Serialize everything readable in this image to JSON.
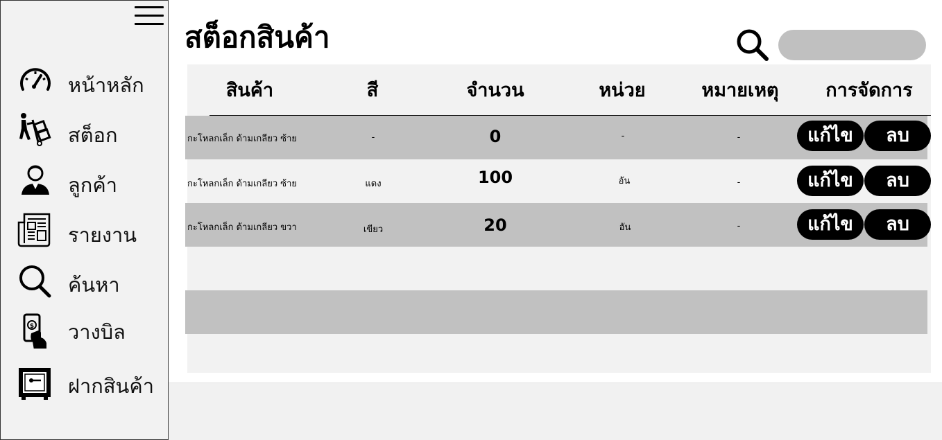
{
  "sidebar": {
    "items": [
      {
        "label": "หน้าหลัก",
        "icon": "speedometer-icon"
      },
      {
        "label": "สต็อก",
        "icon": "hand-truck-icon"
      },
      {
        "label": "ลูกค้า",
        "icon": "customer-icon"
      },
      {
        "label": "รายงาน",
        "icon": "newspaper-icon"
      },
      {
        "label": "ค้นหา",
        "icon": "search-icon"
      },
      {
        "label": "วางบิล",
        "icon": "payment-phone-icon"
      },
      {
        "label": "ฝากสินค้า",
        "icon": "safe-icon"
      }
    ]
  },
  "header": {
    "title": "สต็อกสินค้า",
    "search_placeholder": ""
  },
  "table": {
    "columns": [
      "สินค้า",
      "สี",
      "จำนวน",
      "หน่วย",
      "หมายเหตุ",
      "การจัดการ"
    ],
    "rows": [
      {
        "name": "กะโหลกเล็ก ด้ามเกลียว ซ้าย",
        "color": "-",
        "qty": "0",
        "unit": "-",
        "note": "-",
        "edit": "แก้ไข",
        "delete": "ลบ"
      },
      {
        "name": "กะโหลกเล็ก ด้ามเกลียว ซ้าย",
        "color": "แดง",
        "qty": "100",
        "unit": "อัน",
        "note": "-",
        "edit": "แก้ไข",
        "delete": "ลบ"
      },
      {
        "name": "กะโหลกเล็ก ด้ามเกลียว ขวา",
        "color": "เขียว",
        "qty": "20",
        "unit": "อัน",
        "note": "-",
        "edit": "แก้ไข",
        "delete": "ลบ"
      }
    ]
  },
  "colors": {
    "sidebar_bg": "#f2f2f2",
    "table_bg": "#f2f2f2",
    "row_shade": "#c1c1c1",
    "search_bg": "#c0c0c0",
    "button_bg": "#000000",
    "button_text": "#ffffff"
  }
}
